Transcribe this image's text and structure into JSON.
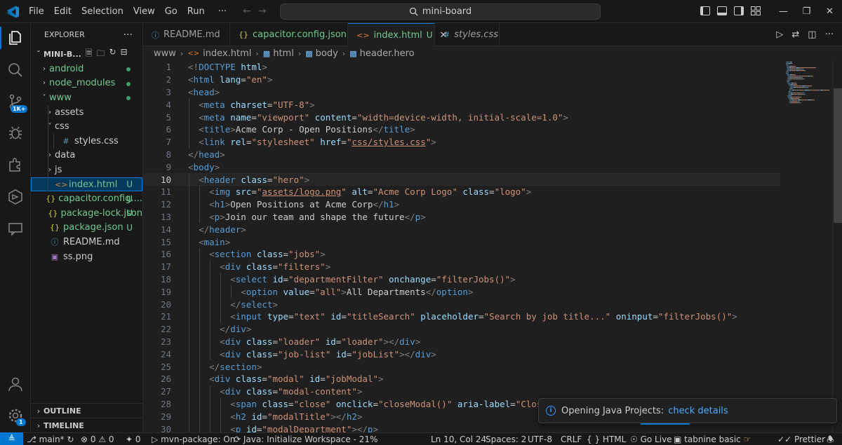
{
  "menubar": {
    "items": [
      "File",
      "Edit",
      "Selection",
      "View",
      "Go",
      "Run"
    ],
    "more": "···"
  },
  "command_center": {
    "text": "mini-board"
  },
  "activity_bar": {
    "source_control_badge": "1K+",
    "settings_badge": "1"
  },
  "sidebar": {
    "title": "EXPLORER",
    "more": "···",
    "root": "MINI-B...",
    "tree": [
      {
        "label": "android",
        "depth": 1,
        "chev": "›",
        "icon": "",
        "status": "",
        "dot": true,
        "color": "#73c991"
      },
      {
        "label": "node_modules",
        "depth": 1,
        "chev": "›",
        "icon": "",
        "status": "",
        "dot": true,
        "color": "#73c991"
      },
      {
        "label": "www",
        "depth": 1,
        "chev": "˅",
        "icon": "",
        "status": "",
        "dot": true,
        "color": "#73c991"
      },
      {
        "label": "assets",
        "depth": 2,
        "chev": "›",
        "icon": "",
        "status": "",
        "dot": false,
        "color": "#cccccc"
      },
      {
        "label": "css",
        "depth": 2,
        "chev": "˅",
        "icon": "",
        "status": "",
        "dot": false,
        "color": "#cccccc"
      },
      {
        "label": "styles.css",
        "depth": 3,
        "chev": "",
        "icon": "#",
        "status": "",
        "dot": false,
        "color": "#cccccc"
      },
      {
        "label": "data",
        "depth": 2,
        "chev": "›",
        "icon": "",
        "status": "",
        "dot": false,
        "color": "#cccccc"
      },
      {
        "label": "js",
        "depth": 2,
        "chev": "›",
        "icon": "",
        "status": "",
        "dot": false,
        "color": "#cccccc"
      },
      {
        "label": "index.html",
        "depth": 2,
        "chev": "",
        "icon": "<>",
        "status": "U",
        "dot": false,
        "color": "#73c991",
        "selected": true
      },
      {
        "label": "capacitor.config....",
        "depth": 1,
        "chev": "",
        "icon": "{}",
        "status": "U",
        "dot": false,
        "color": "#73c991"
      },
      {
        "label": "package-lock.json",
        "depth": 1,
        "chev": "",
        "icon": "{}",
        "status": "U",
        "dot": false,
        "color": "#73c991"
      },
      {
        "label": "package.json",
        "depth": 1,
        "chev": "",
        "icon": "{}",
        "status": "U",
        "dot": false,
        "color": "#73c991"
      },
      {
        "label": "README.md",
        "depth": 1,
        "chev": "",
        "icon": "ⓘ",
        "status": "",
        "dot": false,
        "color": "#cccccc"
      },
      {
        "label": "ss.png",
        "depth": 1,
        "chev": "",
        "icon": "▣",
        "status": "",
        "dot": false,
        "color": "#cccccc"
      }
    ],
    "outline": "OUTLINE",
    "timeline": "TIMELINE"
  },
  "tabs": [
    {
      "label": "README.md",
      "icon": "ⓘ",
      "status": "",
      "active": false,
      "italic": false,
      "icon_color": "#519aba"
    },
    {
      "label": "capacitor.config.json",
      "icon": "{}",
      "status": "U",
      "active": false,
      "italic": false,
      "icon_color": "#cbcb41"
    },
    {
      "label": "index.html",
      "icon": "<>",
      "status": "U",
      "active": true,
      "italic": false,
      "icon_color": "#e37933"
    },
    {
      "label": "styles.css",
      "icon": "#",
      "status": "",
      "active": false,
      "italic": true,
      "icon_color": "#519aba"
    }
  ],
  "breadcrumb": [
    "www",
    "index.html",
    "html",
    "body",
    "header.hero"
  ],
  "editor": {
    "current_line": 10,
    "lines": [
      [
        [
          "tg",
          "<!"
        ],
        [
          "tn",
          "DOCTYPE"
        ],
        [
          "tx",
          " "
        ],
        [
          "an",
          "html"
        ],
        [
          "tg",
          ">"
        ]
      ],
      [
        [
          "tg",
          "<"
        ],
        [
          "tn",
          "html"
        ],
        [
          "tx",
          " "
        ],
        [
          "an",
          "lang"
        ],
        [
          "tx",
          "="
        ],
        [
          "av",
          "\"en\""
        ],
        [
          "tg",
          ">"
        ]
      ],
      [
        [
          "tg",
          "<"
        ],
        [
          "tn",
          "head"
        ],
        [
          "tg",
          ">"
        ]
      ],
      [
        [
          "tx",
          "  "
        ],
        [
          "tg",
          "<"
        ],
        [
          "tn",
          "meta"
        ],
        [
          "tx",
          " "
        ],
        [
          "an",
          "charset"
        ],
        [
          "tx",
          "="
        ],
        [
          "av",
          "\"UTF-8\""
        ],
        [
          "tg",
          ">"
        ]
      ],
      [
        [
          "tx",
          "  "
        ],
        [
          "tg",
          "<"
        ],
        [
          "tn",
          "meta"
        ],
        [
          "tx",
          " "
        ],
        [
          "an",
          "name"
        ],
        [
          "tx",
          "="
        ],
        [
          "av",
          "\"viewport\""
        ],
        [
          "tx",
          " "
        ],
        [
          "an",
          "content"
        ],
        [
          "tx",
          "="
        ],
        [
          "av",
          "\"width=device-width, initial-scale=1.0\""
        ],
        [
          "tg",
          ">"
        ]
      ],
      [
        [
          "tx",
          "  "
        ],
        [
          "tg",
          "<"
        ],
        [
          "tn",
          "title"
        ],
        [
          "tg",
          ">"
        ],
        [
          "tx",
          "Acme Corp - Open Positions"
        ],
        [
          "tg",
          "</"
        ],
        [
          "tn",
          "title"
        ],
        [
          "tg",
          ">"
        ]
      ],
      [
        [
          "tx",
          "  "
        ],
        [
          "tg",
          "<"
        ],
        [
          "tn",
          "link"
        ],
        [
          "tx",
          " "
        ],
        [
          "an",
          "rel"
        ],
        [
          "tx",
          "="
        ],
        [
          "av",
          "\"stylesheet\""
        ],
        [
          "tx",
          " "
        ],
        [
          "an",
          "href"
        ],
        [
          "tx",
          "="
        ],
        [
          "av",
          "\""
        ],
        [
          "avu",
          "css/styles.css"
        ],
        [
          "av",
          "\""
        ],
        [
          "tg",
          ">"
        ]
      ],
      [
        [
          "tg",
          "</"
        ],
        [
          "tn",
          "head"
        ],
        [
          "tg",
          ">"
        ]
      ],
      [
        [
          "tg",
          "<"
        ],
        [
          "tn",
          "body"
        ],
        [
          "tg",
          ">"
        ]
      ],
      [
        [
          "tx",
          "  "
        ],
        [
          "tg",
          "<"
        ],
        [
          "tn",
          "header"
        ],
        [
          "tx",
          " "
        ],
        [
          "an",
          "class"
        ],
        [
          "tx",
          "="
        ],
        [
          "av",
          "\"hero\""
        ],
        [
          "tg",
          ">"
        ]
      ],
      [
        [
          "tx",
          "    "
        ],
        [
          "tg",
          "<"
        ],
        [
          "tn",
          "img"
        ],
        [
          "tx",
          " "
        ],
        [
          "an",
          "src"
        ],
        [
          "tx",
          "="
        ],
        [
          "av",
          "\""
        ],
        [
          "avu",
          "assets/logo.png"
        ],
        [
          "av",
          "\""
        ],
        [
          "tx",
          " "
        ],
        [
          "an",
          "alt"
        ],
        [
          "tx",
          "="
        ],
        [
          "av",
          "\"Acme Corp Logo\""
        ],
        [
          "tx",
          " "
        ],
        [
          "an",
          "class"
        ],
        [
          "tx",
          "="
        ],
        [
          "av",
          "\"logo\""
        ],
        [
          "tg",
          ">"
        ]
      ],
      [
        [
          "tx",
          "    "
        ],
        [
          "tg",
          "<"
        ],
        [
          "tn",
          "h1"
        ],
        [
          "tg",
          ">"
        ],
        [
          "tx",
          "Open Positions at Acme Corp"
        ],
        [
          "tg",
          "</"
        ],
        [
          "tn",
          "h1"
        ],
        [
          "tg",
          ">"
        ]
      ],
      [
        [
          "tx",
          "    "
        ],
        [
          "tg",
          "<"
        ],
        [
          "tn",
          "p"
        ],
        [
          "tg",
          ">"
        ],
        [
          "tx",
          "Join our team and shape the future"
        ],
        [
          "tg",
          "</"
        ],
        [
          "tn",
          "p"
        ],
        [
          "tg",
          ">"
        ]
      ],
      [
        [
          "tx",
          "  "
        ],
        [
          "tg",
          "</"
        ],
        [
          "tn",
          "header"
        ],
        [
          "tg",
          ">"
        ]
      ],
      [
        [
          "tx",
          "  "
        ],
        [
          "tg",
          "<"
        ],
        [
          "tn",
          "main"
        ],
        [
          "tg",
          ">"
        ]
      ],
      [
        [
          "tx",
          "    "
        ],
        [
          "tg",
          "<"
        ],
        [
          "tn",
          "section"
        ],
        [
          "tx",
          " "
        ],
        [
          "an",
          "class"
        ],
        [
          "tx",
          "="
        ],
        [
          "av",
          "\"jobs\""
        ],
        [
          "tg",
          ">"
        ]
      ],
      [
        [
          "tx",
          "      "
        ],
        [
          "tg",
          "<"
        ],
        [
          "tn",
          "div"
        ],
        [
          "tx",
          " "
        ],
        [
          "an",
          "class"
        ],
        [
          "tx",
          "="
        ],
        [
          "av",
          "\"filters\""
        ],
        [
          "tg",
          ">"
        ]
      ],
      [
        [
          "tx",
          "        "
        ],
        [
          "tg",
          "<"
        ],
        [
          "tn",
          "select"
        ],
        [
          "tx",
          " "
        ],
        [
          "an",
          "id"
        ],
        [
          "tx",
          "="
        ],
        [
          "av",
          "\"departmentFilter\""
        ],
        [
          "tx",
          " "
        ],
        [
          "an",
          "onchange"
        ],
        [
          "tx",
          "="
        ],
        [
          "av",
          "\"filterJobs()\""
        ],
        [
          "tg",
          ">"
        ]
      ],
      [
        [
          "tx",
          "          "
        ],
        [
          "tg",
          "<"
        ],
        [
          "tn",
          "option"
        ],
        [
          "tx",
          " "
        ],
        [
          "an",
          "value"
        ],
        [
          "tx",
          "="
        ],
        [
          "av",
          "\"all\""
        ],
        [
          "tg",
          ">"
        ],
        [
          "tx",
          "All Departments"
        ],
        [
          "tg",
          "</"
        ],
        [
          "tn",
          "option"
        ],
        [
          "tg",
          ">"
        ]
      ],
      [
        [
          "tx",
          "        "
        ],
        [
          "tg",
          "</"
        ],
        [
          "tn",
          "select"
        ],
        [
          "tg",
          ">"
        ]
      ],
      [
        [
          "tx",
          "        "
        ],
        [
          "tg",
          "<"
        ],
        [
          "tn",
          "input"
        ],
        [
          "tx",
          " "
        ],
        [
          "an",
          "type"
        ],
        [
          "tx",
          "="
        ],
        [
          "av",
          "\"text\""
        ],
        [
          "tx",
          " "
        ],
        [
          "an",
          "id"
        ],
        [
          "tx",
          "="
        ],
        [
          "av",
          "\"titleSearch\""
        ],
        [
          "tx",
          " "
        ],
        [
          "an",
          "placeholder"
        ],
        [
          "tx",
          "="
        ],
        [
          "av",
          "\"Search by job title...\""
        ],
        [
          "tx",
          " "
        ],
        [
          "an",
          "oninput"
        ],
        [
          "tx",
          "="
        ],
        [
          "av",
          "\"filterJobs()\""
        ],
        [
          "tg",
          ">"
        ]
      ],
      [
        [
          "tx",
          "      "
        ],
        [
          "tg",
          "</"
        ],
        [
          "tn",
          "div"
        ],
        [
          "tg",
          ">"
        ]
      ],
      [
        [
          "tx",
          "      "
        ],
        [
          "tg",
          "<"
        ],
        [
          "tn",
          "div"
        ],
        [
          "tx",
          " "
        ],
        [
          "an",
          "class"
        ],
        [
          "tx",
          "="
        ],
        [
          "av",
          "\"loader\""
        ],
        [
          "tx",
          " "
        ],
        [
          "an",
          "id"
        ],
        [
          "tx",
          "="
        ],
        [
          "av",
          "\"loader\""
        ],
        [
          "tg",
          "></"
        ],
        [
          "tn",
          "div"
        ],
        [
          "tg",
          ">"
        ]
      ],
      [
        [
          "tx",
          "      "
        ],
        [
          "tg",
          "<"
        ],
        [
          "tn",
          "div"
        ],
        [
          "tx",
          " "
        ],
        [
          "an",
          "class"
        ],
        [
          "tx",
          "="
        ],
        [
          "av",
          "\"job-list\""
        ],
        [
          "tx",
          " "
        ],
        [
          "an",
          "id"
        ],
        [
          "tx",
          "="
        ],
        [
          "av",
          "\"jobList\""
        ],
        [
          "tg",
          "></"
        ],
        [
          "tn",
          "div"
        ],
        [
          "tg",
          ">"
        ]
      ],
      [
        [
          "tx",
          "    "
        ],
        [
          "tg",
          "</"
        ],
        [
          "tn",
          "section"
        ],
        [
          "tg",
          ">"
        ]
      ],
      [
        [
          "tx",
          "    "
        ],
        [
          "tg",
          "<"
        ],
        [
          "tn",
          "div"
        ],
        [
          "tx",
          " "
        ],
        [
          "an",
          "class"
        ],
        [
          "tx",
          "="
        ],
        [
          "av",
          "\"modal\""
        ],
        [
          "tx",
          " "
        ],
        [
          "an",
          "id"
        ],
        [
          "tx",
          "="
        ],
        [
          "av",
          "\"jobModal\""
        ],
        [
          "tg",
          ">"
        ]
      ],
      [
        [
          "tx",
          "      "
        ],
        [
          "tg",
          "<"
        ],
        [
          "tn",
          "div"
        ],
        [
          "tx",
          " "
        ],
        [
          "an",
          "class"
        ],
        [
          "tx",
          "="
        ],
        [
          "av",
          "\"modal-content\""
        ],
        [
          "tg",
          ">"
        ]
      ],
      [
        [
          "tx",
          "        "
        ],
        [
          "tg",
          "<"
        ],
        [
          "tn",
          "span"
        ],
        [
          "tx",
          " "
        ],
        [
          "an",
          "class"
        ],
        [
          "tx",
          "="
        ],
        [
          "av",
          "\"close\""
        ],
        [
          "tx",
          " "
        ],
        [
          "an",
          "onclick"
        ],
        [
          "tx",
          "="
        ],
        [
          "av",
          "\"closeModal()\""
        ],
        [
          "tx",
          " "
        ],
        [
          "an",
          "aria-label"
        ],
        [
          "tx",
          "="
        ],
        [
          "av",
          "\"Close"
        ]
      ],
      [
        [
          "tx",
          "        "
        ],
        [
          "tg",
          "<"
        ],
        [
          "tn",
          "h2"
        ],
        [
          "tx",
          " "
        ],
        [
          "an",
          "id"
        ],
        [
          "tx",
          "="
        ],
        [
          "av",
          "\"modalTitle\""
        ],
        [
          "tg",
          "></"
        ],
        [
          "tn",
          "h2"
        ],
        [
          "tg",
          ">"
        ]
      ],
      [
        [
          "tx",
          "        "
        ],
        [
          "tg",
          "<"
        ],
        [
          "tn",
          "p"
        ],
        [
          "tx",
          " "
        ],
        [
          "an",
          "id"
        ],
        [
          "tx",
          "="
        ],
        [
          "av",
          "\"modalDepartment\""
        ],
        [
          "tg",
          "></"
        ],
        [
          "tn",
          "p"
        ],
        [
          "tg",
          ">"
        ]
      ]
    ]
  },
  "notification": {
    "text": "Opening Java Projects:",
    "link": "check details"
  },
  "statusbar": {
    "branch": "main*",
    "problems": "⊗ 0 ⚠ 0",
    "ports": "0",
    "task": "mvn-package: On",
    "java": "Java: Initialize Workspace - 21%",
    "position": "Ln 10, Col 24",
    "spaces": "Spaces: 2",
    "encoding": "UTF-8",
    "eol": "CRLF",
    "language": "HTML",
    "golive": "Go Live",
    "tabnine": "tabnine basic",
    "prettier": "Prettier"
  }
}
